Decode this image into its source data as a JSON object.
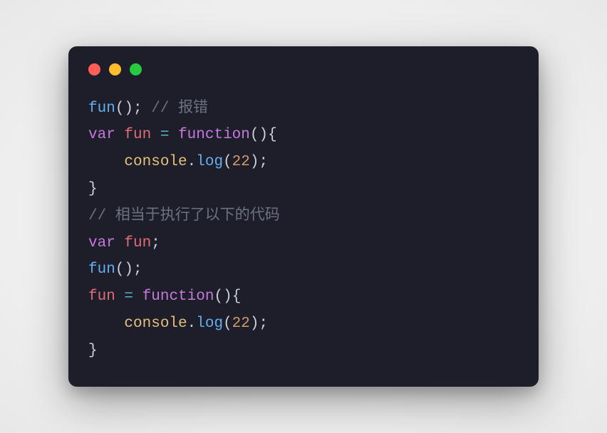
{
  "window": {
    "traffic_lights": {
      "red": "close",
      "yellow": "minimize",
      "green": "zoom"
    }
  },
  "code": {
    "lines": [
      {
        "tokens": [
          {
            "type": "fn",
            "text": "fun"
          },
          {
            "type": "paren",
            "text": "("
          },
          {
            "type": "paren",
            "text": ")"
          },
          {
            "type": "punct",
            "text": ";"
          },
          {
            "type": "plain",
            "text": " "
          },
          {
            "type": "comment",
            "text": "// 报错"
          }
        ]
      },
      {
        "tokens": [
          {
            "type": "keyword",
            "text": "var"
          },
          {
            "type": "plain",
            "text": " "
          },
          {
            "type": "ident",
            "text": "fun"
          },
          {
            "type": "plain",
            "text": " "
          },
          {
            "type": "assign",
            "text": "="
          },
          {
            "type": "plain",
            "text": " "
          },
          {
            "type": "funckw",
            "text": "function"
          },
          {
            "type": "paren",
            "text": "("
          },
          {
            "type": "paren",
            "text": ")"
          },
          {
            "type": "brace",
            "text": "{"
          }
        ]
      },
      {
        "tokens": [
          {
            "type": "plain",
            "text": "    "
          },
          {
            "type": "builtin",
            "text": "console"
          },
          {
            "type": "punct",
            "text": "."
          },
          {
            "type": "method",
            "text": "log"
          },
          {
            "type": "paren",
            "text": "("
          },
          {
            "type": "number",
            "text": "22"
          },
          {
            "type": "paren",
            "text": ")"
          },
          {
            "type": "punct",
            "text": ";"
          }
        ]
      },
      {
        "tokens": [
          {
            "type": "brace",
            "text": "}"
          }
        ]
      },
      {
        "tokens": [
          {
            "type": "comment",
            "text": "// 相当于执行了以下的代码"
          }
        ]
      },
      {
        "tokens": [
          {
            "type": "keyword",
            "text": "var"
          },
          {
            "type": "plain",
            "text": " "
          },
          {
            "type": "ident",
            "text": "fun"
          },
          {
            "type": "punct",
            "text": ";"
          }
        ]
      },
      {
        "tokens": [
          {
            "type": "fn",
            "text": "fun"
          },
          {
            "type": "paren",
            "text": "("
          },
          {
            "type": "paren",
            "text": ")"
          },
          {
            "type": "punct",
            "text": ";"
          }
        ]
      },
      {
        "tokens": [
          {
            "type": "ident",
            "text": "fun"
          },
          {
            "type": "plain",
            "text": " "
          },
          {
            "type": "assign",
            "text": "="
          },
          {
            "type": "plain",
            "text": " "
          },
          {
            "type": "funckw",
            "text": "function"
          },
          {
            "type": "paren",
            "text": "("
          },
          {
            "type": "paren",
            "text": ")"
          },
          {
            "type": "brace",
            "text": "{"
          }
        ]
      },
      {
        "tokens": [
          {
            "type": "plain",
            "text": "    "
          },
          {
            "type": "builtin",
            "text": "console"
          },
          {
            "type": "punct",
            "text": "."
          },
          {
            "type": "method",
            "text": "log"
          },
          {
            "type": "paren",
            "text": "("
          },
          {
            "type": "number",
            "text": "22"
          },
          {
            "type": "paren",
            "text": ")"
          },
          {
            "type": "punct",
            "text": ";"
          }
        ]
      },
      {
        "tokens": [
          {
            "type": "brace",
            "text": "}"
          }
        ]
      }
    ]
  }
}
